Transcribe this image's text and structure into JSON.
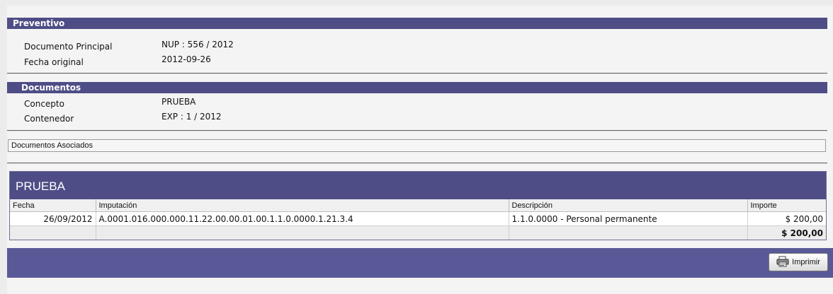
{
  "preventivo": {
    "title": "Preventivo",
    "rows": [
      {
        "label": "Documento Principal",
        "value": "NUP : 556 / 2012"
      },
      {
        "label": "Fecha original",
        "value": "2012-09-26"
      }
    ]
  },
  "documentos": {
    "title": "Documentos",
    "rows": [
      {
        "label": "Concepto",
        "value": "PRUEBA"
      },
      {
        "label": "Contenedor",
        "value": "EXP : 1 / 2012"
      }
    ]
  },
  "asociados": {
    "label": "Documentos Asociados"
  },
  "grid": {
    "title": "PRUEBA",
    "columns": [
      "Fecha",
      "Imputación",
      "Descripción",
      "Importe"
    ],
    "rows": [
      {
        "fecha": "26/09/2012",
        "imputacion": "A.0001.016.000.000.11.22.00.00.01.00.1.1.0.0000.1.21.3.4",
        "descripcion": "1.1.0.0000 - Personal permanente",
        "importe": "$ 200,00"
      }
    ],
    "total": "$ 200,00"
  },
  "actions": {
    "print_label": "Imprimir",
    "print_icon": "printer-icon"
  }
}
